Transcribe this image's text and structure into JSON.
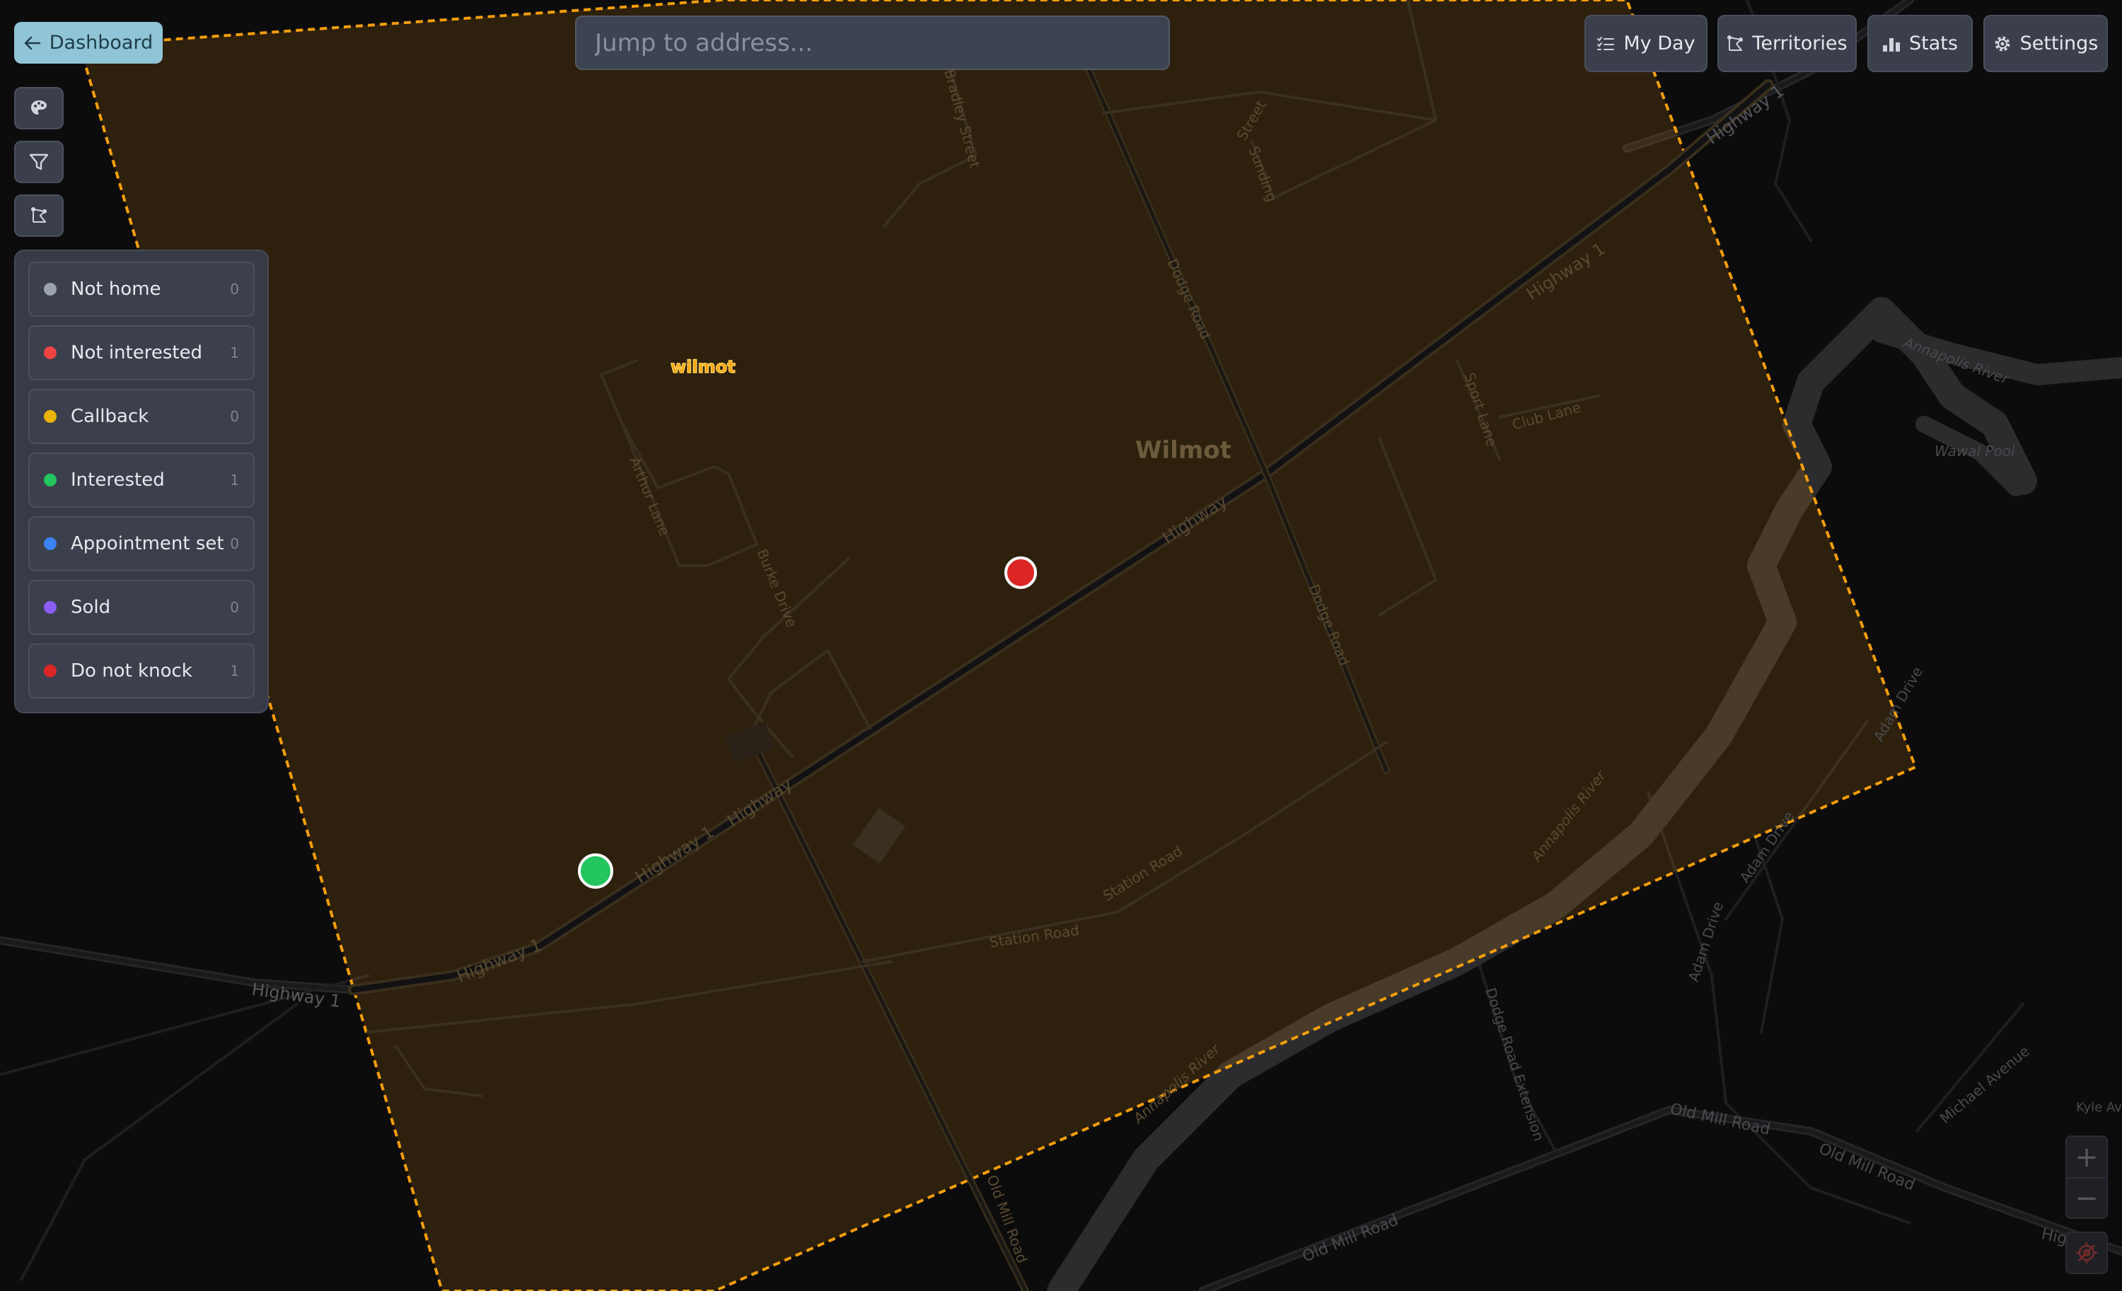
{
  "header": {
    "back_label": "Dashboard",
    "search_placeholder": "Jump to address...",
    "nav": [
      {
        "label": "My Day",
        "icon": "list-check-icon"
      },
      {
        "label": "Territories",
        "icon": "polygon-icon"
      },
      {
        "label": "Stats",
        "icon": "bar-chart-icon"
      },
      {
        "label": "Settings",
        "icon": "gear-icon"
      }
    ]
  },
  "toolbar": {
    "tools": [
      "map-style-icon",
      "filter-icon",
      "territory-draw-icon"
    ]
  },
  "legend": {
    "items": [
      {
        "label": "Not home",
        "count": "0",
        "color": "#9ca3af"
      },
      {
        "label": "Not interested",
        "count": "1",
        "color": "#ef4444"
      },
      {
        "label": "Callback",
        "count": "0",
        "color": "#eab308"
      },
      {
        "label": "Interested",
        "count": "1",
        "color": "#22c55e"
      },
      {
        "label": "Appointment set",
        "count": "0",
        "color": "#3b82f6"
      },
      {
        "label": "Sold",
        "count": "0",
        "color": "#8b5cf6"
      },
      {
        "label": "Do not knock",
        "count": "1",
        "color": "#dc2626"
      }
    ]
  },
  "map": {
    "territory_name": "wilmot",
    "territory_color": "#f59e0b",
    "place_label": "Wilmot",
    "road_labels": {
      "highway": "Highway 1",
      "highway_short": "Highway",
      "dodge": "Dodge Road",
      "bradley": "Bradley Street",
      "arthur": "Arthur Lane",
      "burke": "Burke Drive",
      "station": "Station Road",
      "sport": "Sport Lane",
      "club": "Club Lane",
      "old_mill": "Old Mill Road",
      "dodge_ext": "Dodge Road Extension",
      "adam": "Adam Drive",
      "michael": "Michael Avenue",
      "kyle": "Kyle Av",
      "street": "Street",
      "sunding": "Sunding"
    },
    "water_labels": {
      "river": "Annapolis River",
      "pool": "Wawal Pool"
    },
    "pins": [
      {
        "status": "Not interested",
        "color": "#dc2626"
      },
      {
        "status": "Interested",
        "color": "#22c55e"
      }
    ]
  },
  "controls": {
    "zoom_in": "+",
    "zoom_out": "−"
  }
}
